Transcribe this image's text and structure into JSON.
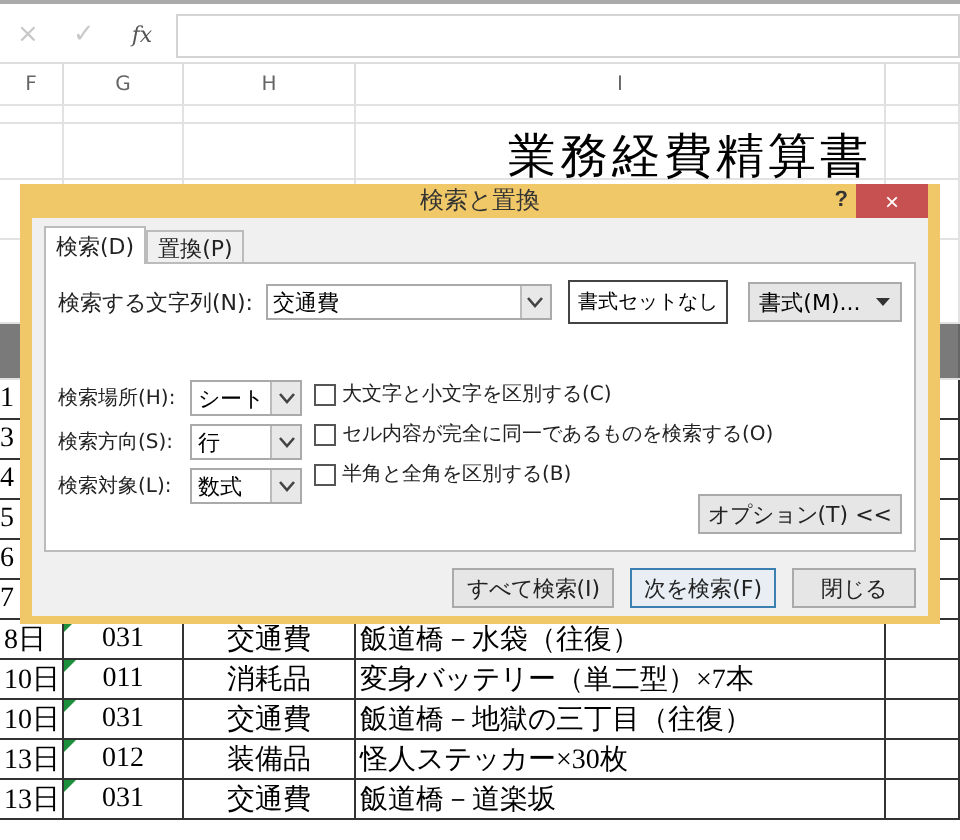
{
  "formula_bar": {
    "cancel_icon": "×",
    "enter_icon": "✓",
    "function_icon": "fx"
  },
  "column_headers": [
    "F",
    "G",
    "H",
    "I"
  ],
  "title": "業務経費精算書",
  "partial_rows": [
    "1",
    "3",
    "4",
    "5",
    "6",
    "7"
  ],
  "rows": [
    {
      "date": "8日",
      "code": "031",
      "category": "交通費",
      "detail": "飯道橋－水袋（往復）",
      "error_mark": true
    },
    {
      "date": "10日",
      "code": "011",
      "category": "消耗品",
      "detail": "変身バッテリー（単二型）×7本",
      "error_mark": true
    },
    {
      "date": "10日",
      "code": "031",
      "category": "交通費",
      "detail": "飯道橋－地獄の三丁目（往復）",
      "error_mark": true
    },
    {
      "date": "13日",
      "code": "012",
      "category": "装備品",
      "detail": "怪人ステッカー×30枚",
      "error_mark": true
    },
    {
      "date": "13日",
      "code": "031",
      "category": "交通費",
      "detail": "飯道橋－道楽坂",
      "error_mark": true
    }
  ],
  "dialog": {
    "title": "検索と置換",
    "help": "?",
    "close": "×",
    "tabs": [
      {
        "label": "検索(D)",
        "selected": true
      },
      {
        "label": "置換(P)",
        "selected": false
      }
    ],
    "find_label": "検索する文字列(N):",
    "find_value": "交通費",
    "format_status": "書式セットなし",
    "format_button": "書式(M)...",
    "options": [
      {
        "label": "検索場所(H):",
        "value": "シート"
      },
      {
        "label": "検索方向(S):",
        "value": "行"
      },
      {
        "label": "検索対象(L):",
        "value": "数式"
      }
    ],
    "checkboxes": [
      {
        "label": "大文字と小文字を区別する(C)",
        "checked": false
      },
      {
        "label": "セル内容が完全に同一であるものを検索する(O)",
        "checked": false
      },
      {
        "label": "半角と全角を区別する(B)",
        "checked": false
      }
    ],
    "options_button": "オプション(T) <<",
    "buttons": [
      {
        "label": "すべて検索(I)",
        "kind": "normal"
      },
      {
        "label": "次を検索(F)",
        "kind": "default"
      },
      {
        "label": "閉じる",
        "kind": "normal"
      }
    ]
  }
}
